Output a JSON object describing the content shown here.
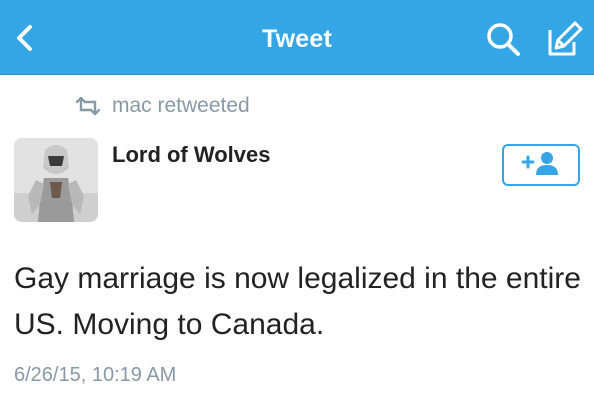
{
  "navbar": {
    "title": "Tweet",
    "back_icon": "back-chevron-icon",
    "search_icon": "search-icon",
    "compose_icon": "compose-icon",
    "background": "#34a6e6"
  },
  "retweet": {
    "icon": "retweet-icon",
    "text": "mac retweeted"
  },
  "tweet": {
    "author_name": "Lord of Wolves",
    "avatar_icon": "avatar",
    "follow_icon": "add-user-icon",
    "text": "Gay marriage is now legalized in the entire US. Moving to Canada.",
    "timestamp": "6/26/15, 10:19 AM"
  },
  "colors": {
    "accent": "#34a6e6",
    "muted_text": "#8899a6",
    "body_text": "#222222"
  }
}
